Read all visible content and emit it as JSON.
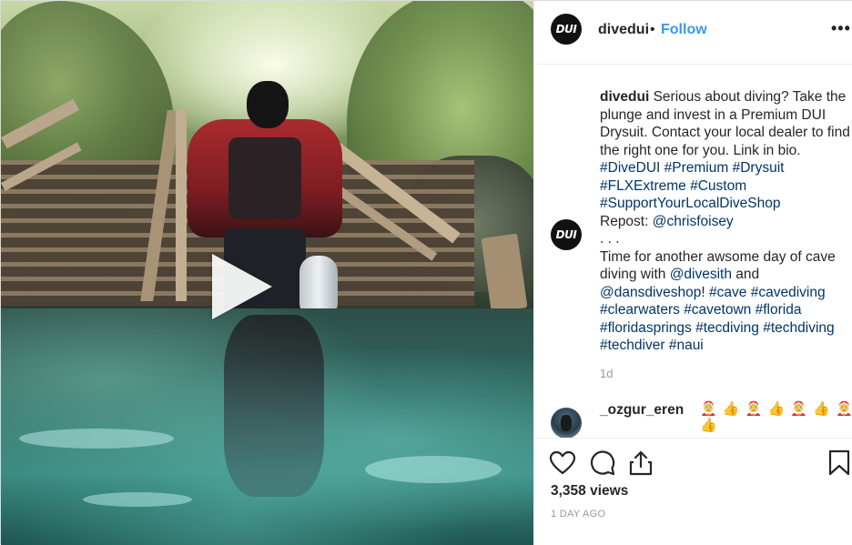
{
  "post": {
    "username": "divedui",
    "avatar_text": "DUI",
    "separator": "•",
    "follow_label": "Follow",
    "more_label": "•••"
  },
  "caption": {
    "username": "divedui",
    "line1": " Serious about diving? Take the plunge and invest in a Premium DUI Drysuit. Contact your local dealer to find the right one for you. Link in bio. ",
    "tag_divedui": "#DiveDUI",
    "tag_premium": "#Premium",
    "tag_drysuit": "#Drysuit",
    "tag_flxextreme": "#FLXExtreme",
    "tag_custom": "#Custom",
    "tag_support": "#SupportYourLocalDiveShop",
    "repost_label": "Repost: ",
    "mention_chris": "@chrisfoisey",
    "ellipsis": ". . .",
    "line2": "Time for another awsome day of cave diving with ",
    "mention_divesith": "@divesith",
    "and": " and ",
    "mention_dansdiveshop": "@dansdiveshop",
    "excl": "! ",
    "tag_cave": "#cave",
    "tag_cavediving": "#cavediving",
    "tag_clearwaters": "#clearwaters",
    "tag_cavetown": "#cavetown",
    "tag_florida": "#florida",
    "tag_floridasprings": "#floridasprings",
    "tag_tecdiving": "#tecdiving",
    "tag_techdiving": "#techdiving",
    "tag_techdiver": "#techdiver",
    "tag_naui": "#naui"
  },
  "time_ago": "1d",
  "comment": {
    "username": "_ozgur_eren",
    "text": "🤶 👍 🤶 👍 🤶 👍 🤶 👍"
  },
  "stats": {
    "views": "3,358 views",
    "date": "1 DAY AGO"
  },
  "icons": {
    "like": "heart-icon",
    "comment": "comment-icon",
    "share": "share-icon",
    "save": "bookmark-icon",
    "play": "play-icon"
  },
  "colors": {
    "link_blue": "#3897f0",
    "hashtag": "#003569",
    "muted": "#999999",
    "text": "#262626"
  }
}
